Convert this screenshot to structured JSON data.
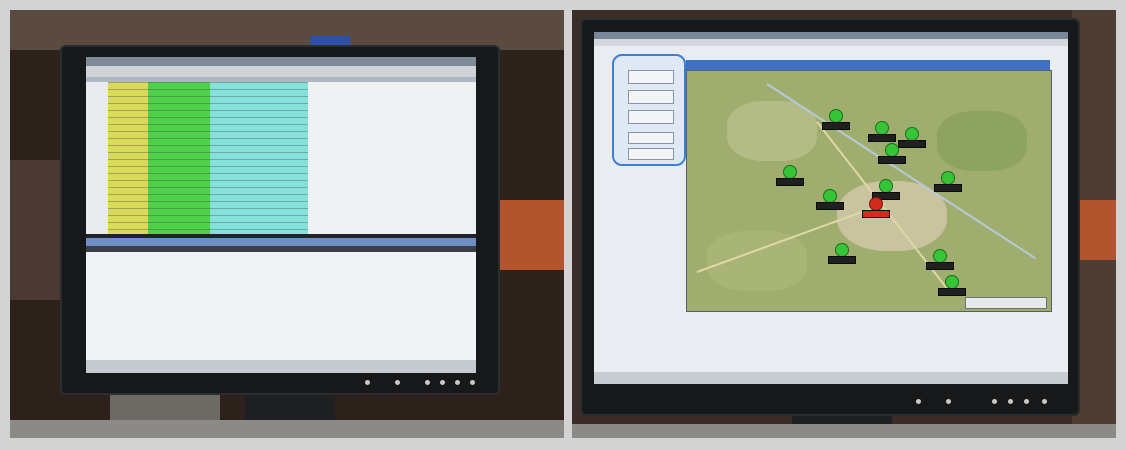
{
  "photo_left": {
    "monitor_brand": "",
    "table_rows": 22
  },
  "photo_right": {
    "monitor_brand": "",
    "map_markers": [
      {
        "status": "green"
      },
      {
        "status": "green"
      },
      {
        "status": "green"
      },
      {
        "status": "green"
      },
      {
        "status": "green"
      },
      {
        "status": "green"
      },
      {
        "status": "green"
      },
      {
        "status": "green"
      },
      {
        "status": "red"
      },
      {
        "status": "green"
      },
      {
        "status": "green"
      },
      {
        "status": "green"
      }
    ]
  },
  "colors": {
    "map_land": "#9fae6e",
    "marker_green": "#36c536",
    "marker_red": "#d42a1c",
    "table_yellow": "#d9d95a",
    "table_green": "#4fd04a",
    "table_cyan": "#86e1dc"
  }
}
